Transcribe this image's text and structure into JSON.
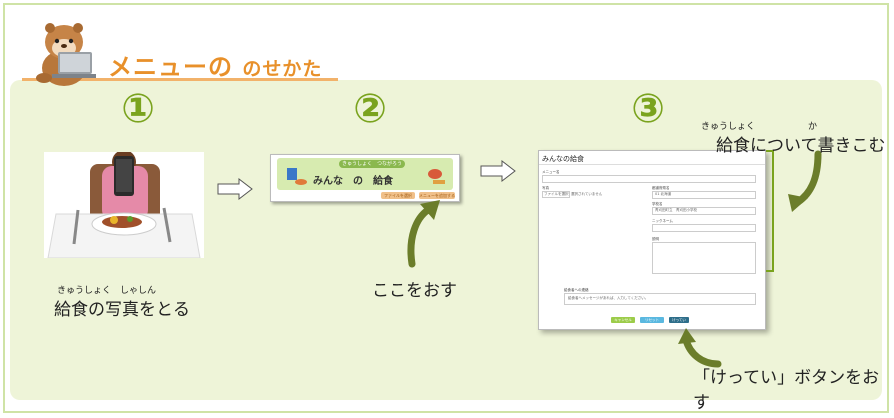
{
  "title": {
    "main": "メニューの",
    "rest": "のせかた"
  },
  "steps": [
    {
      "number": "①",
      "ruby_top": "きゅうしょく　しゃしん",
      "caption": "給食の写真をとる"
    },
    {
      "number": "②",
      "caption": "ここをおす"
    },
    {
      "number": "③",
      "ruby_kyushoku": "きゅうしょく",
      "ruby_ka": "か",
      "caption": "給食について書きこむ",
      "bottom_caption": "「けってい」ボタンをおす"
    }
  ],
  "step2_screen": {
    "pill": "きゅうしょく　つながろう",
    "banner_title": "みんな　の　給食",
    "button_left": "ファイルを選択",
    "button_right": "メニューを追加する"
  },
  "step3_screen": {
    "title": "みんなの給食",
    "menu_label": "メニュー名",
    "photo_label": "写真",
    "file_button": "ファイルを選択",
    "file_status": "選択されていません",
    "pref_label": "都道府県名",
    "pref_value": "01 北海道",
    "school_label": "学校名",
    "school_value": "青刈田町立　青刈田小学校",
    "nickname_label": "ニックネーム",
    "desc_label": "説明",
    "message_label": "給食者への連絡",
    "message_placeholder": "給食者へメッセージがあれば、入力してください。",
    "btn_cancel": "キャンセル",
    "btn_reset": "リセット",
    "btn_ok": "けってい"
  },
  "colors": {
    "green": "#7aa31e",
    "orange": "#e8902a",
    "panel": "#eef4d8"
  }
}
